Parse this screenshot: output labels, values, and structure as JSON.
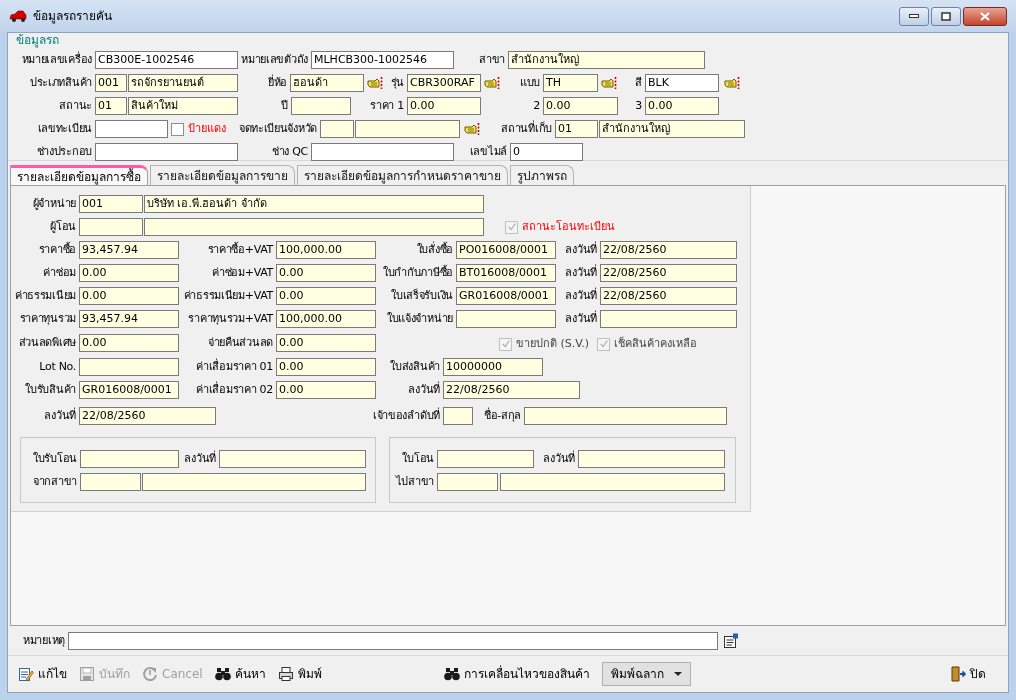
{
  "window": {
    "title": "ข้อมูลรถรายคัน"
  },
  "vehicle": {
    "title": "ข้อมูลรถ",
    "engine_no": {
      "label": "หมายเลขเครื่อง",
      "value": "CB300E-1002546",
      "readonly": false
    },
    "chassis_no": {
      "label": "หมายเลขตัวถัง",
      "value": "MLHCB300-1002546",
      "readonly": false
    },
    "branch": {
      "label": "สาขา",
      "value": "สำนักงานใหญ่",
      "readonly": true
    },
    "product_type_code": {
      "label": "ประเภทสินค้า",
      "value": "001",
      "readonly": true
    },
    "product_type_name": {
      "value": "รถจักรยานยนต์",
      "readonly": true
    },
    "brand": {
      "label": "ยี่ห้อ",
      "value": "ฮอนด้า",
      "readonly": true
    },
    "model": {
      "label": "รุ่น",
      "value": "CBR300RAF",
      "readonly": true
    },
    "style": {
      "label": "แบบ",
      "value": "TH",
      "readonly": true
    },
    "paint": {
      "label": "สี",
      "value": "BLK",
      "readonly": false
    },
    "status_code": {
      "label": "สถานะ",
      "value": "01",
      "readonly": true
    },
    "status_name": {
      "value": "สินค้าใหม่",
      "readonly": true
    },
    "year": {
      "label": "ปี",
      "readonly": true
    },
    "price_1": {
      "label": "ราคา 1",
      "value": "0.00",
      "readonly": true
    },
    "price_2": {
      "label": "2",
      "value": "0.00",
      "readonly": true
    },
    "price_3": {
      "label": "3",
      "value": "0.00",
      "readonly": true
    },
    "plate_no": {
      "label": "เลขทะเบียน",
      "readonly": false
    },
    "red_plate": {
      "label": "ป้ายแดง",
      "checked": false,
      "disabled": false
    },
    "province_code": {
      "label": "จดทะเบียนจังหวัด",
      "readonly": true
    },
    "province_name": {
      "readonly": true
    },
    "storage_code": {
      "label": "สถานที่เก็บ",
      "value": "01",
      "readonly": true
    },
    "storage_name": {
      "value": "สำนักงานใหญ่",
      "readonly": true
    },
    "assembler": {
      "label": "ช่างประกอบ",
      "readonly": false
    },
    "qc": {
      "label": "ช่าง QC",
      "readonly": false
    },
    "mileage": {
      "label": "เลขไมล์",
      "value": "0",
      "readonly": false
    }
  },
  "tabs": [
    {
      "label": "รายละเอียดข้อมูลการซื้อ",
      "selected": true
    },
    {
      "label": "รายละเอียดข้อมูลการขาย",
      "selected": false
    },
    {
      "label": "รายละเอียดข้อมูลการกำหนดราคาขาย",
      "selected": false
    },
    {
      "label": "รูปภาพรถ",
      "selected": false
    }
  ],
  "purchase": {
    "supplier_code": {
      "label": "ผู้จำหน่าย",
      "value": "001",
      "readonly": true
    },
    "supplier_name": {
      "value": "บริษัท เอ.พี.ฮอนด้า จำกัด",
      "readonly": true
    },
    "transferor_code": {
      "label": "ผู้โอน",
      "readonly": true
    },
    "transferor_name": {
      "readonly": true
    },
    "transfer_status": {
      "label": "สถานะโอนทะเบียน",
      "checked": true,
      "disabled": true
    },
    "price": {
      "label": "ราคาซื้อ",
      "value": "93,457.94",
      "readonly": true
    },
    "price_vat": {
      "label": "ราคาซื้อ+VAT",
      "value": "100,000.00",
      "readonly": true
    },
    "po_no": {
      "label": "ใบสั่งซื้อ",
      "value": "PO016008/0001",
      "readonly": true
    },
    "po_date": {
      "label": "ลงวันที่",
      "value": "22/08/2560",
      "readonly": true
    },
    "repair": {
      "label": "ค่าซ่อม",
      "value": "0.00",
      "readonly": true
    },
    "repair_vat": {
      "label": "ค่าซ่อม+VAT",
      "value": "0.00",
      "readonly": true
    },
    "tax_invoice": {
      "label": "ใบกำกับภาษีซื้อ",
      "value": "BT016008/0001",
      "readonly": true
    },
    "tax_invoice_date": {
      "label": "ลงวันที่",
      "value": "22/08/2560",
      "readonly": true
    },
    "fee": {
      "label": "ค่าธรรมเนียม",
      "value": "0.00",
      "readonly": true
    },
    "fee_vat": {
      "label": "ค่าธรรมเนียม+VAT",
      "value": "0.00",
      "readonly": true
    },
    "receipt": {
      "label": "ใบเสร็จรับเงิน",
      "value": "GR016008/0001",
      "readonly": true
    },
    "receipt_date": {
      "label": "ลงวันที่",
      "value": "22/08/2560",
      "readonly": true
    },
    "total_cost": {
      "label": "ราคาทุนรวม",
      "value": "93,457.94",
      "readonly": true
    },
    "total_cost_vat": {
      "label": "ราคาทุนรวม+VAT",
      "value": "100,000.00",
      "readonly": true
    },
    "sale_notice": {
      "label": "ใบแจ้งจำหน่าย",
      "readonly": true
    },
    "sale_notice_date": {
      "label": "ลงวันที่",
      "readonly": true
    },
    "special_discount": {
      "label": "ส่วนลดพิเศษ",
      "value": "0.00",
      "readonly": true
    },
    "discount_refund": {
      "label": "จ่ายคืนส่วนลด",
      "value": "0.00",
      "readonly": true
    },
    "normal_sale": {
      "label": "ขายปกติ (S.V.)",
      "checked": true,
      "disabled": true
    },
    "stock_check": {
      "label": "เช็คสินค้าคงเหลือ",
      "checked": true,
      "disabled": true
    },
    "lot_no": {
      "label": "Lot No.",
      "readonly": true
    },
    "depreciation_01": {
      "label": "ค่าเสื่อมราคา 01",
      "value": "0.00",
      "readonly": true
    },
    "delivery_note": {
      "label": "ใบส่งสินค้า",
      "value": "10000000",
      "readonly": true
    },
    "goods_receipt": {
      "label": "ใบรับสินค้า",
      "value": "GR016008/0001",
      "readonly": true
    },
    "depreciation_02": {
      "label": "ค่าเสื่อมราคา 02",
      "value": "0.00",
      "readonly": true
    },
    "delivery_date": {
      "label": "ลงวันที่",
      "value": "22/08/2560",
      "readonly": true
    },
    "goods_receipt_date": {
      "label": "ลงวันที่",
      "value": "22/08/2560",
      "readonly": true
    },
    "owner_seq": {
      "label": "เจ้าของลำดับที่",
      "readonly": true
    },
    "owner_name": {
      "label": "ชื่อ-สกุล",
      "readonly": true
    }
  },
  "transfer_in": {
    "doc": {
      "label": "ใบรับโอน",
      "readonly": true
    },
    "date": {
      "label": "ลงวันที่",
      "readonly": true
    },
    "branch_code": {
      "label": "จากสาขา",
      "readonly": true
    },
    "branch_name": {
      "readonly": true
    }
  },
  "transfer_out": {
    "doc": {
      "label": "ใบโอน",
      "readonly": true
    },
    "date": {
      "label": "ลงวันที่",
      "readonly": true
    },
    "branch_code": {
      "label": "ไปสาขา",
      "readonly": true
    },
    "branch_name": {
      "readonly": true
    }
  },
  "remark": {
    "label": "หมายเหตุ",
    "readonly": false
  },
  "toolbar": [
    {
      "kind": "edit",
      "label": "แก้ไข",
      "disabled": false
    },
    {
      "kind": "save",
      "label": "บันทึก",
      "disabled": true
    },
    {
      "kind": "cancel",
      "label": "Cancel",
      "disabled": true
    },
    {
      "kind": "search",
      "label": "ค้นหา",
      "disabled": false
    },
    {
      "kind": "print",
      "label": "พิมพ์",
      "disabled": false
    }
  ],
  "movement_button": {
    "label": "การเคลื่อนไหวของสินค้า"
  },
  "print_label_dropdown": {
    "label": "พิมพ์ฉลาก"
  },
  "close_button": {
    "label": "ปิด"
  }
}
